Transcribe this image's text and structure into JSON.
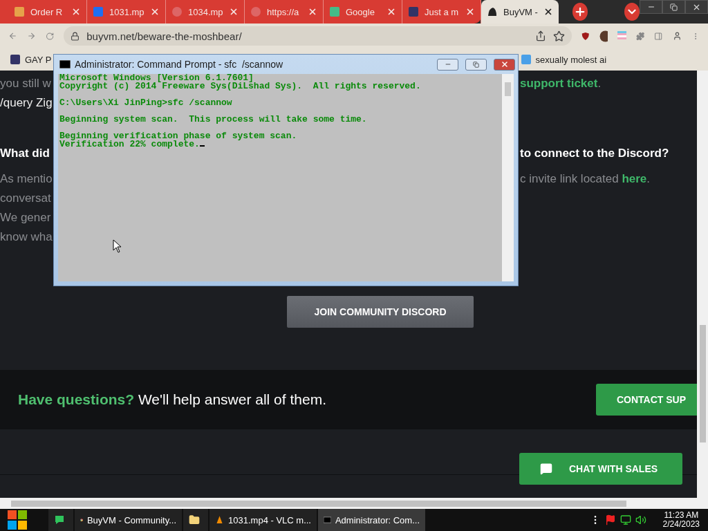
{
  "browser": {
    "tabs": [
      {
        "title": "Order R",
        "kind": "picture",
        "selected": false
      },
      {
        "title": "1031.mp",
        "kind": "box",
        "selected": false
      },
      {
        "title": "1034.mp",
        "kind": "globe",
        "selected": false
      },
      {
        "title": "https://a",
        "kind": "globe",
        "selected": false
      },
      {
        "title": "Google",
        "kind": "colors",
        "selected": false
      },
      {
        "title": "Just a m",
        "kind": "computer",
        "selected": false
      },
      {
        "title": "BuyVM -",
        "kind": "bear",
        "selected": true
      }
    ],
    "address": "buyvm.net/beware-the-moshbear/",
    "bookmarks": [
      {
        "label": "GAY P",
        "kind": "computer"
      },
      {
        "label": "sexually molest ai",
        "kind": "page"
      }
    ]
  },
  "page": {
    "lines": [
      {
        "kind": "body",
        "left": "you still w",
        "right": [
          {
            "text": "support ticket",
            "link": true
          },
          {
            "text": ".",
            "link": false
          }
        ]
      },
      {
        "kind": "command",
        "left": "/query Zig"
      },
      {
        "kind": "heading",
        "left": "What did",
        "right": [
          {
            "text": "to connect to the Discord?",
            "link": false
          }
        ]
      },
      {
        "kind": "body",
        "left": "As mentio",
        "right": [
          {
            "text": "c invite link located ",
            "link": false
          },
          {
            "text": "here",
            "link": true
          },
          {
            "text": ".",
            "link": false
          }
        ]
      },
      {
        "kind": "body",
        "left": "conversat"
      },
      {
        "kind": "body",
        "left": "We gener"
      },
      {
        "kind": "body",
        "left": "know wha"
      }
    ],
    "discord_button": "JOIN COMMUNITY DISCORD",
    "band": {
      "accent": "Have questions?",
      "text": "We'll help answer all of them.",
      "button": "CONTACT SUP"
    },
    "chat_button": "CHAT WITH SALES"
  },
  "console": {
    "title": "Administrator: Command Prompt - sfc  /scannow",
    "paragraphs": [
      [
        "Microsoft Windows [Version 6.1.7601]",
        "Copyright (c) 2014 Freeware Sys(DiLshad Sys).  All rights reserved."
      ],
      [
        "C:\\Users\\Xi JinPing>sfc /scannow"
      ],
      [
        "Beginning system scan.  This process will take some time."
      ],
      [
        "Beginning verification phase of system scan.",
        "Verification 22% complete."
      ]
    ],
    "cursor_visible": true
  },
  "taskbar": {
    "items": [
      {
        "kind": "chat"
      },
      {
        "kind": "chrome",
        "label": "BuyVM - Community..."
      },
      {
        "kind": "folder"
      },
      {
        "kind": "vlc",
        "label": "1031.mp4 - VLC m..."
      },
      {
        "kind": "cmd",
        "label": "Administrator: Com...",
        "selected": true
      }
    ],
    "time": "11:23 AM",
    "date": "2/24/2023"
  }
}
